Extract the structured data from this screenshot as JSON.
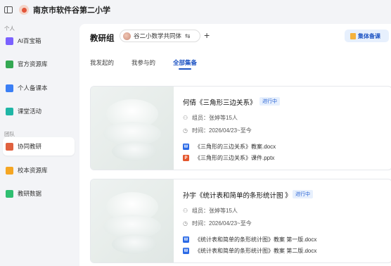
{
  "app": {
    "school_name": "南京市软件谷第二小学"
  },
  "sidebar": {
    "group_personal": "个人",
    "group_team": "团队",
    "items": [
      {
        "label": "AI百宝箱",
        "icon": "ai-toolbox-icon",
        "color": "#7b61ff"
      },
      {
        "label": "官方资源库",
        "icon": "official-resource-icon",
        "color": "#34a853"
      },
      {
        "label": "个人备课本",
        "icon": "lesson-book-icon",
        "color": "#3b7ff5"
      },
      {
        "label": "课堂活动",
        "icon": "class-activity-icon",
        "color": "#1fb6a6"
      },
      {
        "label": "协同教研",
        "icon": "collab-research-icon",
        "color": "#e0613f",
        "active": true
      },
      {
        "label": "校本资源库",
        "icon": "school-resource-icon",
        "color": "#f5a623"
      },
      {
        "label": "教研数据",
        "icon": "research-data-icon",
        "color": "#2fbf71"
      }
    ]
  },
  "header": {
    "title": "教研组",
    "group_name": "谷二小数学共同体",
    "swap_glyph": "⇆",
    "add_glyph": "+",
    "collect_button": "集体备课"
  },
  "tabs": [
    {
      "label": "我发起的"
    },
    {
      "label": "我参与的"
    },
    {
      "label": "全部集备",
      "active": true
    }
  ],
  "cards": [
    {
      "title": "何倩《三角形三边关系》",
      "status": "进行中",
      "members": "组员：张婷等15人",
      "time": "时间：2026/04/23~至今",
      "files": [
        {
          "name": "《三角形的三边关系》教案.docx",
          "type": "W",
          "color": "#2b6ae6"
        },
        {
          "name": "《三角形的三边关系》课件.pptx",
          "type": "P",
          "color": "#e4572e"
        }
      ]
    },
    {
      "title": "孙宇《统计表和简单的条形统计图 》",
      "status": "进行中",
      "members": "组员：张婷等15人",
      "time": "时间：2026/04/23~至今",
      "files": [
        {
          "name": "《统计表和简单的条形统计图》教案 第一版.docx",
          "type": "W",
          "color": "#2b6ae6"
        },
        {
          "name": "《统计表和简单的条形统计图》教案 第二版.docx",
          "type": "W",
          "color": "#2b6ae6"
        }
      ]
    }
  ]
}
